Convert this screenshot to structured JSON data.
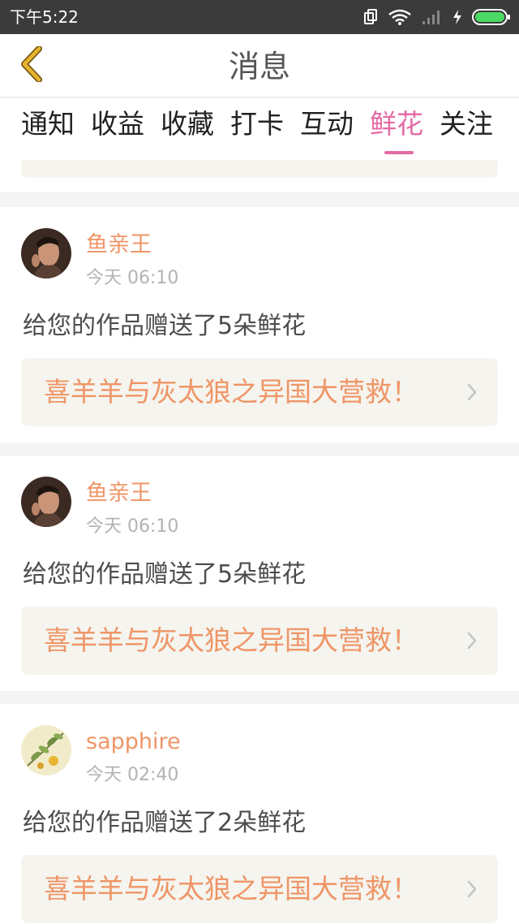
{
  "status_bar": {
    "time": "下午5:22",
    "icons": [
      "screen-rotate-icon",
      "wifi-icon",
      "signal-icon",
      "charging-icon",
      "battery-icon"
    ],
    "battery_color": "#4cd964"
  },
  "header": {
    "title": "消息",
    "back_icon": "chevron-left-icon",
    "back_icon_color": "#e8b431"
  },
  "tabs": [
    {
      "label": "通知"
    },
    {
      "label": "收益"
    },
    {
      "label": "收藏"
    },
    {
      "label": "打卡"
    },
    {
      "label": "互动"
    },
    {
      "label": "鲜花",
      "active": true
    },
    {
      "label": "关注"
    }
  ],
  "accent_colors": {
    "active_tab": "#e46aa4",
    "username": "#ef9566",
    "work_title": "#ef9566"
  },
  "feed": [
    {
      "username": "鱼亲王",
      "avatar": "user-avatar-photo",
      "time": "今天 06:10",
      "message": "给您的作品赠送了5朵鲜花",
      "work_title": "喜羊羊与灰太狼之异国大营救！"
    },
    {
      "username": "鱼亲王",
      "avatar": "user-avatar-photo",
      "time": "今天 06:10",
      "message": "给您的作品赠送了5朵鲜花",
      "work_title": "喜羊羊与灰太狼之异国大营救！"
    },
    {
      "username": "sapphire",
      "avatar": "botanical-avatar",
      "time": "今天 02:40",
      "message": "给您的作品赠送了2朵鲜花",
      "work_title": "喜羊羊与灰太狼之异国大营救！"
    }
  ]
}
